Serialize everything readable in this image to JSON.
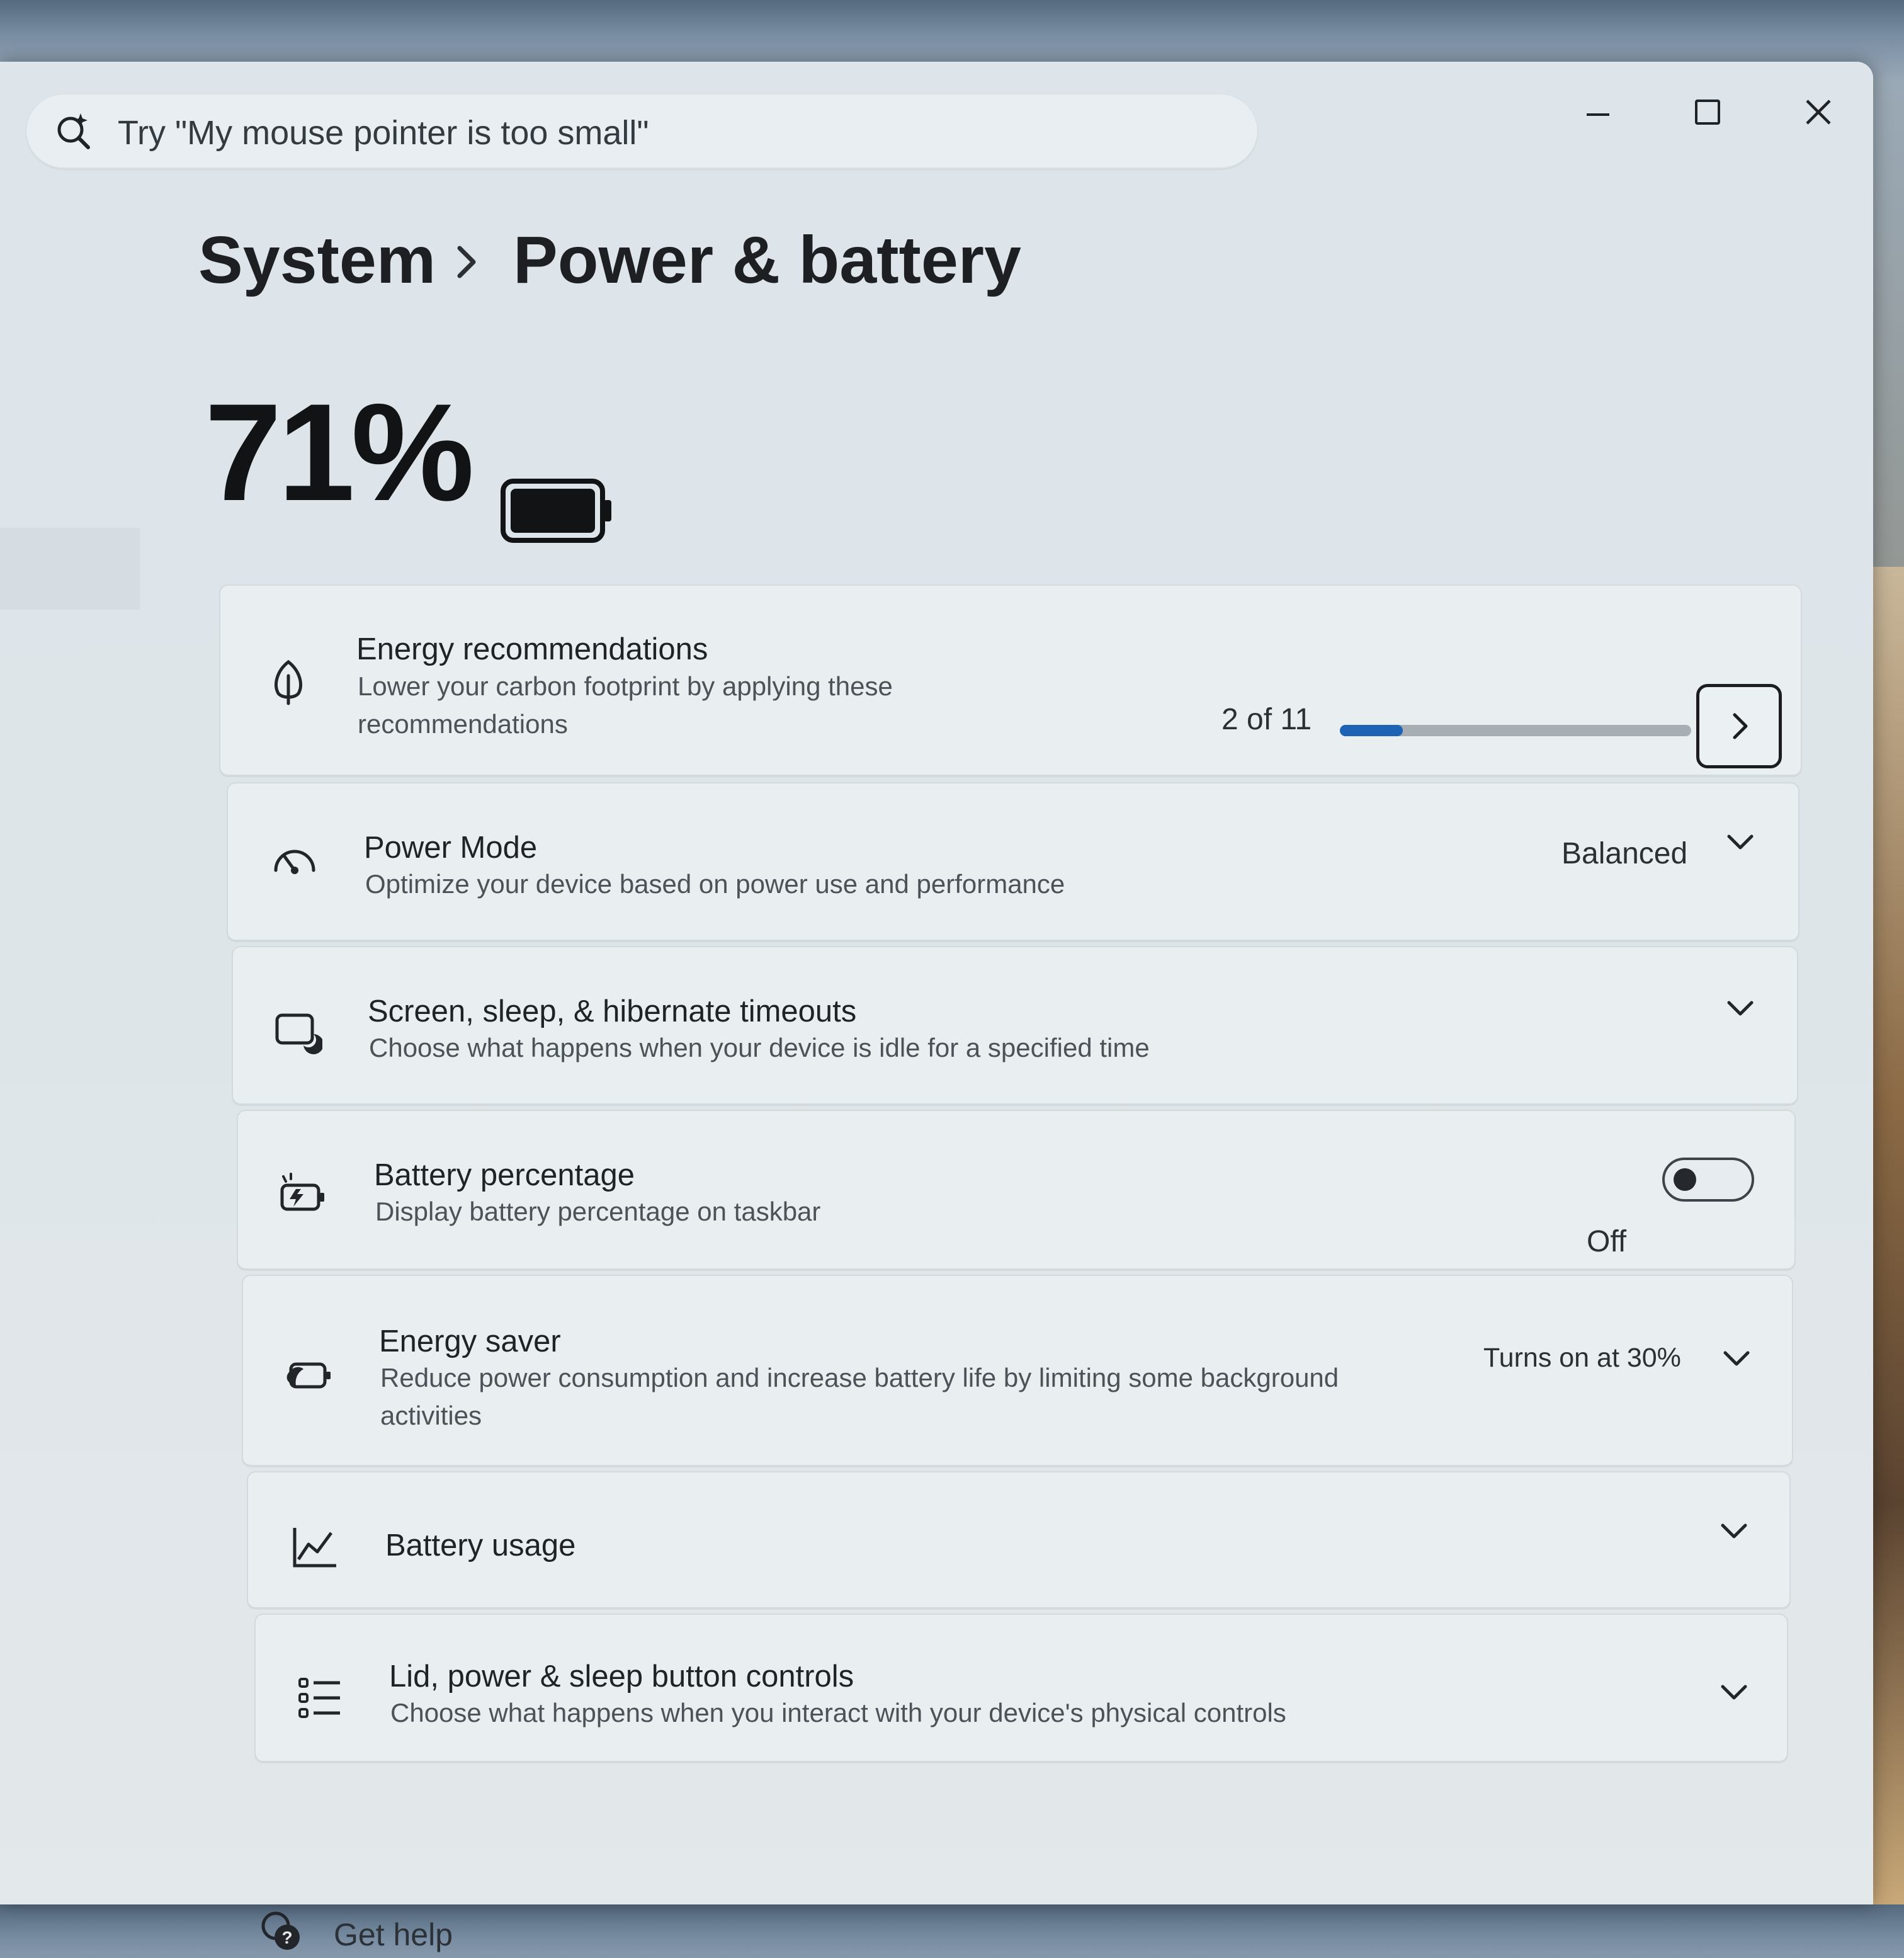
{
  "search": {
    "placeholder": "Try \"My mouse pointer is too small\""
  },
  "window_controls": {
    "minimize_icon": "minimize-icon",
    "maximize_icon": "maximize-icon",
    "close_icon": "close-icon"
  },
  "breadcrumb": {
    "parent": "System",
    "separator_icon": "chevron-right-icon",
    "current": "Power & battery"
  },
  "battery": {
    "percent_text": "71%",
    "level": 0.71,
    "icon": "battery-icon"
  },
  "settings": [
    {
      "id": "energy-recommendations",
      "icon": "leaf-icon",
      "title": "Energy recommendations",
      "description": "Lower your carbon footprint by applying these recommendations",
      "value": "2 of 11",
      "progress": 0.18,
      "action": "chevron-right-icon"
    },
    {
      "id": "power-mode",
      "icon": "speedometer-icon",
      "title": "Power Mode",
      "description": "Optimize your device based on power use and performance",
      "value": "Balanced",
      "action": "chevron-down-icon"
    },
    {
      "id": "screen-sleep",
      "icon": "screen-moon-icon",
      "title": "Screen, sleep, & hibernate timeouts",
      "description": "Choose what happens when your device is idle for a specified time",
      "action": "chevron-down-icon"
    },
    {
      "id": "battery-percentage",
      "icon": "battery-charge-icon",
      "title": "Battery percentage",
      "description": "Display battery percentage on taskbar",
      "value": "Off",
      "toggle_on": false
    },
    {
      "id": "energy-saver",
      "icon": "energy-saver-icon",
      "title": "Energy saver",
      "description": "Reduce power consumption and increase battery life by limiting some background activities",
      "value": "Turns on at 30%",
      "action": "chevron-down-icon"
    },
    {
      "id": "battery-usage",
      "icon": "line-chart-icon",
      "title": "Battery usage",
      "action": "chevron-down-icon"
    },
    {
      "id": "lid-power-sleep",
      "icon": "list-controls-icon",
      "title": "Lid, power & sleep button controls",
      "description": "Choose what happens when you interact with your device's physical controls",
      "action": "chevron-down-icon"
    }
  ],
  "footer": {
    "help_icon": "help-chat-icon",
    "help_label": "Get help"
  },
  "colors": {
    "accent": "#1e62b5",
    "card_bg": "#e9eef1",
    "window_bg": "#dee5e9",
    "text_primary": "#1f2326",
    "text_secondary": "#4b5258"
  }
}
